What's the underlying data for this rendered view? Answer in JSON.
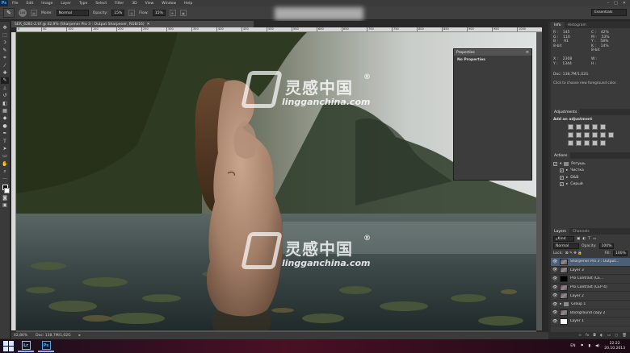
{
  "menubar": {
    "logo": "Ps",
    "items": [
      "File",
      "Edit",
      "Image",
      "Layer",
      "Type",
      "Select",
      "Filter",
      "3D",
      "View",
      "Window",
      "Help"
    ],
    "window_controls": [
      "–",
      "□",
      "✕"
    ]
  },
  "options": {
    "brush_size": "100",
    "mode_label": "Mode:",
    "mode_value": "Normal",
    "opacity_label": "Opacity:",
    "opacity_value": "15%",
    "flow_label": "Flow:",
    "flow_value": "15%",
    "workspace": "Essentials"
  },
  "document": {
    "tab_title": "SER_6281-2.tif @ 42,9% (Sharpener Pro 3 : Output Sharpener, RGB/16)",
    "ruler_ticks": [
      "0",
      "50",
      "100",
      "150",
      "200",
      "250",
      "300",
      "350",
      "400",
      "450",
      "500",
      "550",
      "600",
      "650",
      "700",
      "750",
      "800",
      "850",
      "900",
      "950",
      "1000"
    ],
    "zoom": "42,86%",
    "doc_size": "Doc: 138,7M/1,02G"
  },
  "properties_panel": {
    "tab": "Properties",
    "content": "No Properties"
  },
  "info_panel": {
    "tabs": [
      "Info",
      "Histogram"
    ],
    "rgb": [
      "R :    145",
      "G :    110",
      "B :     91"
    ],
    "cmyk": [
      "C :    42%",
      "M :    53%",
      "Y :    58%",
      "K :    14%"
    ],
    "bitdepth_left": "8-bit",
    "bitdepth_right": "8-bit",
    "xy": [
      "X :    2308",
      "Y :    1344"
    ],
    "wh": [
      "W :",
      "H :"
    ],
    "doc_size": "Doc: 138,7M/1,02G",
    "hint": "Click to choose new foreground color."
  },
  "adjustments": {
    "tab": "Adjustments",
    "title": "Add an adjustment"
  },
  "actions": {
    "tab": "Actions",
    "items": [
      "Ретушь",
      "Чистка",
      "D&B",
      "Сирый"
    ]
  },
  "layers": {
    "tabs": [
      "Layers",
      "Channels"
    ],
    "kind": "Kind",
    "blend": "Normal",
    "opacity_label": "Opacity:",
    "opacity": "100%",
    "lock_label": "Lock:",
    "fill_label": "Fill:",
    "fill": "100%",
    "items": [
      {
        "name": "Sharpener Pro 3 : Output...",
        "thumb": "photo",
        "selected": true
      },
      {
        "name": "Layer 3",
        "thumb": "photo",
        "selected": false
      },
      {
        "name": "Pro Contrast (CE...",
        "thumb": "black",
        "selected": false
      },
      {
        "name": "Pro Contrast (CEP 4)",
        "thumb": "photo",
        "selected": false
      },
      {
        "name": "Layer 2",
        "thumb": "photo",
        "selected": false
      },
      {
        "name": "Group 1",
        "thumb": "folder",
        "selected": false
      },
      {
        "name": "Background copy 2",
        "thumb": "photo",
        "selected": false
      },
      {
        "name": "Layer 1",
        "thumb": "white",
        "selected": false
      }
    ]
  },
  "taskbar": {
    "apps": [
      {
        "label": "Lr",
        "color": "#8cc4ff"
      },
      {
        "label": "Ps",
        "color": "#4fa3f0"
      }
    ],
    "language": "EN",
    "time": "22:22",
    "date": "20.10.2013"
  },
  "watermark": {
    "chinese": "灵感中国",
    "domain": "lingganchina.com",
    "mark": "®"
  },
  "colors": {
    "selection": "#4c5f78",
    "taskbar_accent": "#4a1024"
  }
}
